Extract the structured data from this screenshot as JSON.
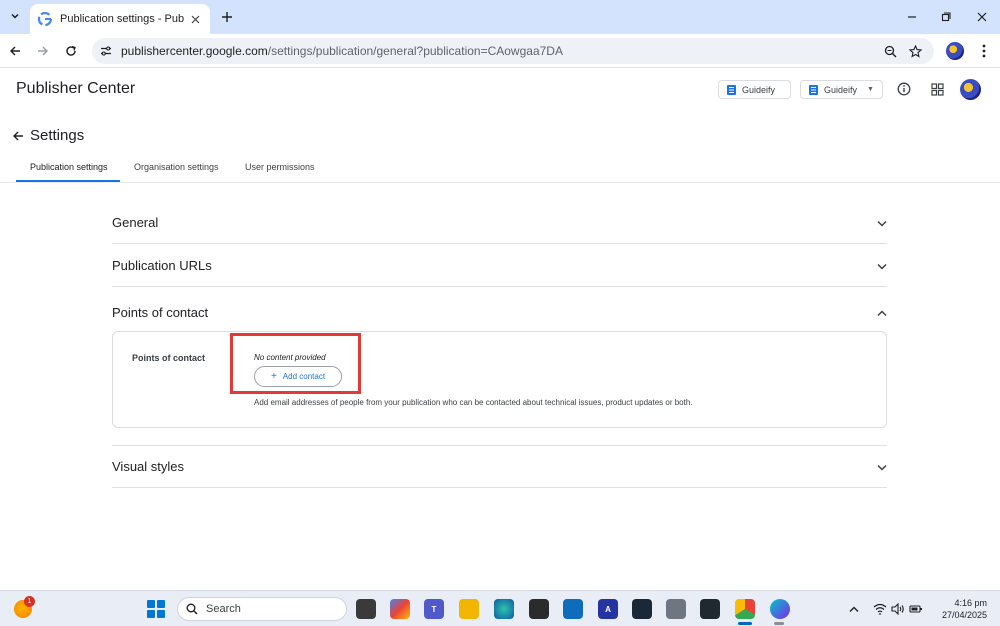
{
  "browser": {
    "tab_title": "Publication settings - Publisher",
    "url_domain": "publishercenter.google.com",
    "url_path": "/settings/publication/general?publication=CAowgaa7DA"
  },
  "app": {
    "title": "Publisher Center",
    "header_buttons": [
      "Guideify",
      "Guideify"
    ]
  },
  "settings": {
    "title": "Settings",
    "tabs": [
      "Publication settings",
      "Organisation settings",
      "User permissions"
    ],
    "sections": {
      "general": "General",
      "publication_urls": "Publication URLs",
      "points_of_contact": "Points of contact",
      "visual_styles": "Visual styles"
    },
    "contact_card": {
      "label": "Points of contact",
      "empty_text": "No content provided",
      "add_button": "Add contact",
      "help_text": "Add email addresses of people from your publication who can be contacted about technical issues, product updates or both."
    }
  },
  "taskbar": {
    "weather_badge": "1",
    "search_label": "Search",
    "time": "4:16 pm",
    "date": "27/04/2025"
  },
  "colors": {
    "accent": "#1a73e8",
    "highlight": "#e53935",
    "tabbar": "#d3e3fd"
  }
}
